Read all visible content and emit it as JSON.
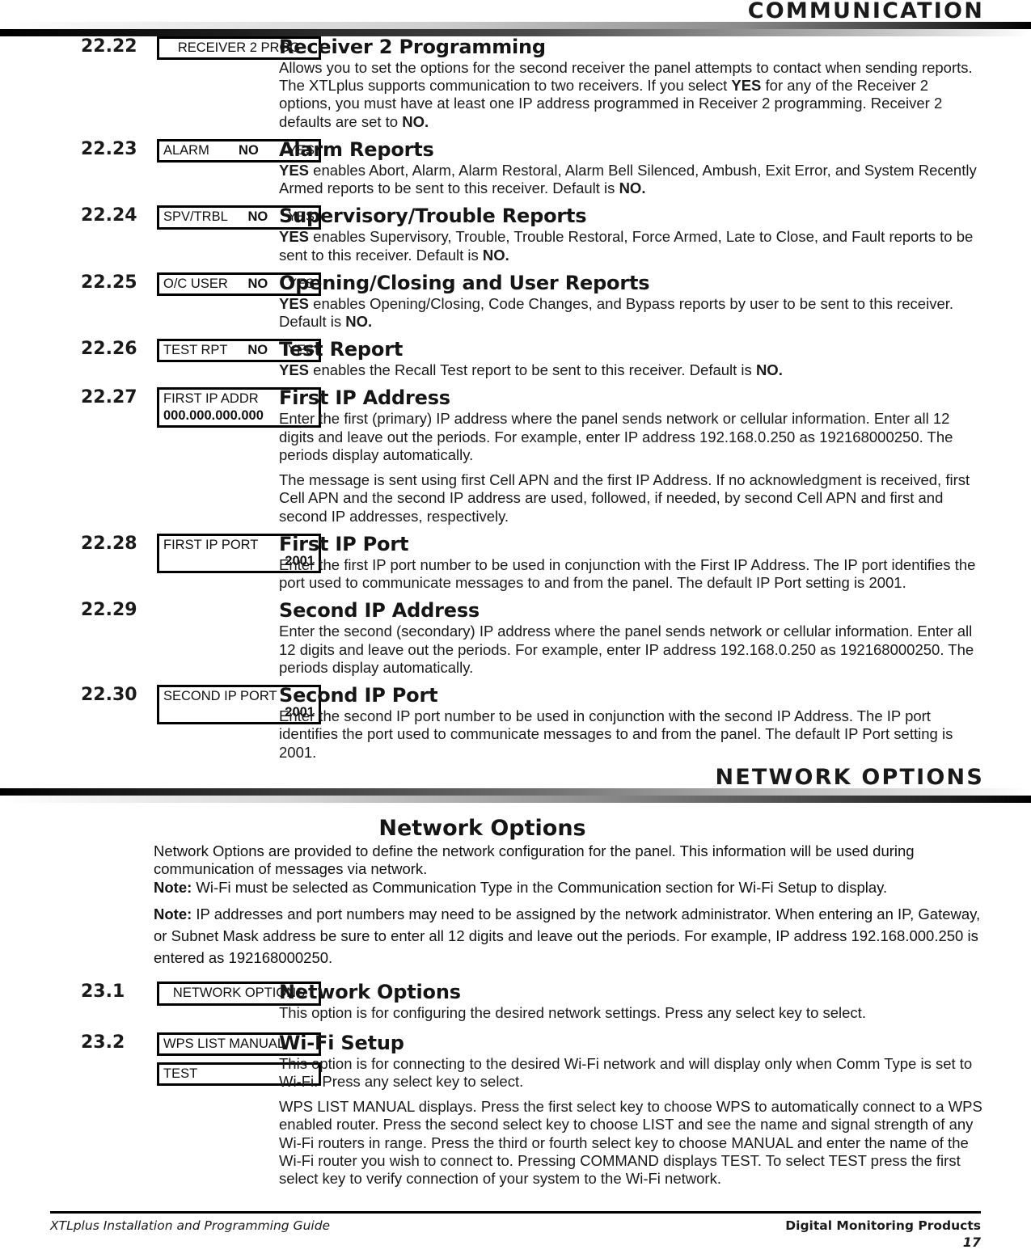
{
  "banners": {
    "communication": "COMMUNICATION",
    "network_options": "NETWORK OPTIONS"
  },
  "sections": [
    {
      "number": "22.22",
      "lcd": [
        {
          "align": "center",
          "line1": "RECEIVER 2 PROG"
        }
      ],
      "heading": "Receiver 2 Programming",
      "paragraphs": [
        "Allows you to set the options for the second receiver the panel attempts to contact when sending reports. The XTLplus supports communication to two receivers. If you select YES for any of the Receiver 2 options, you must have at least one IP address programmed in Receiver 2 programming. Receiver 2 defaults are set to NO."
      ]
    },
    {
      "number": "22.23",
      "lcd": [
        {
          "align": "split",
          "label": "ALARM",
          "mid": "NO",
          "right": "YES"
        }
      ],
      "heading": "Alarm Reports",
      "paragraphs": [
        "YES enables Abort, Alarm, Alarm Restoral, Alarm Bell Silenced, Ambush, Exit Error, and System Recently Armed reports to be sent to this receiver. Default is NO."
      ]
    },
    {
      "number": "22.24",
      "lcd": [
        {
          "align": "split",
          "label": "SPV/TRBL",
          "mid": "NO",
          "right": "YES"
        }
      ],
      "heading": "Supervisory/Trouble Reports",
      "paragraphs": [
        "YES enables Supervisory, Trouble, Trouble Restoral, Force Armed, Late to Close, and Fault reports to be sent to this receiver. Default is NO."
      ]
    },
    {
      "number": "22.25",
      "lcd": [
        {
          "align": "split",
          "label": "O/C USER",
          "mid": "NO",
          "right": "YES"
        }
      ],
      "heading": "Opening/Closing and User Reports",
      "paragraphs": [
        "YES enables Opening/Closing, Code Changes, and Bypass reports by user to be sent to this receiver. Default is NO."
      ]
    },
    {
      "number": "22.26",
      "lcd": [
        {
          "align": "split",
          "label": "TEST RPT",
          "mid": "NO",
          "right": "YES"
        }
      ],
      "heading": "Test Report",
      "paragraphs": [
        "YES enables the Recall Test report to be sent to this receiver. Default is NO."
      ]
    },
    {
      "number": "22.27",
      "lcd": [
        {
          "align": "two-line-left",
          "line1": "FIRST IP ADDR",
          "line2": "000.000.000.000"
        }
      ],
      "heading": "First IP Address",
      "paragraphs": [
        "Enter the first (primary) IP address where the panel sends network or cellular information. Enter all 12 digits and leave out the periods. For example, enter IP address 192.168.0.250 as 192168000250. The periods display automatically.",
        "The message is sent using first Cell APN and the first IP Address. If no acknowledgment is received, first Cell APN and the second IP address are used, followed, if needed, by second Cell APN and first and second IP addresses, respectively."
      ]
    },
    {
      "number": "22.28",
      "lcd": [
        {
          "align": "two-line-right",
          "line1": "FIRST IP PORT",
          "line2": "2001"
        }
      ],
      "heading": "First IP Port",
      "paragraphs": [
        "Enter the first IP port number to be used in conjunction with the First IP Address. The IP port identifies the port used to communicate messages to and from the panel. The default IP Port setting is 2001."
      ]
    },
    {
      "number": "22.29",
      "lcd": [],
      "heading": "Second IP Address",
      "paragraphs": [
        "Enter the second (secondary) IP address where the panel sends network or cellular information. Enter all 12 digits and leave out the periods. For example, enter IP address 192.168.0.250 as 192168000250. The periods display automatically."
      ]
    },
    {
      "number": "22.30",
      "lcd": [
        {
          "align": "two-line-right",
          "line1": "SECOND IP PORT",
          "line2": "2001"
        }
      ],
      "heading": "Second IP Port",
      "paragraphs": [
        "Enter the second IP port number to be used in conjunction with the second IP Address. The IP port identifies the port used to communicate messages to and from the panel. The default IP Port setting is 2001."
      ]
    }
  ],
  "network_intro": {
    "title": "Network Options",
    "paragraph1": "Network Options are provided to define the network configuration for the panel. This information will be used during communication of messages via network.",
    "note1_label": "Note:",
    "note1_text": "Wi-Fi must be selected as Communication Type in the Communication section for Wi-Fi Setup to display.",
    "note2_label": "Note:",
    "note2_text": "IP addresses and port numbers may need to be assigned by the network administrator. When entering an IP, Gateway, or Subnet Mask address be sure to enter all 12 digits and leave out the periods. For example, IP address 192.168.000.250 is entered as 192168000250."
  },
  "sections2": [
    {
      "number": "23.1",
      "lcd": [
        {
          "align": "center",
          "line1": "NETWORK OPTIONS"
        }
      ],
      "heading": "Network Options",
      "paragraphs": [
        "This option is for configuring the desired network settings. Press any select key to select."
      ]
    },
    {
      "number": "23.2",
      "lcd": [
        {
          "align": "left",
          "line1": "WPS  LIST  MANUAL"
        },
        {
          "align": "left",
          "line1": "TEST"
        }
      ],
      "heading": "Wi-Fi Setup",
      "paragraphs": [
        "This option is for connecting to the desired Wi-Fi network and will display only when Comm Type is set to Wi-Fi. Press any select key to select.",
        "WPS  LIST  MANUAL displays. Press the first select key to choose WPS to automatically connect to a WPS enabled router. Press the second select key to choose LIST and see the name and signal strength of any Wi-Fi routers in range. Press the third or fourth select key to choose MANUAL and enter the name of the Wi-Fi router you wish to connect to. Pressing COMMAND displays TEST. To select TEST press the first select key to verify connection of your system to the Wi-Fi network."
      ]
    }
  ],
  "footer": {
    "guide": "XTLplus Installation and Programming Guide",
    "company": "Digital Monitoring Products",
    "page": "17"
  }
}
